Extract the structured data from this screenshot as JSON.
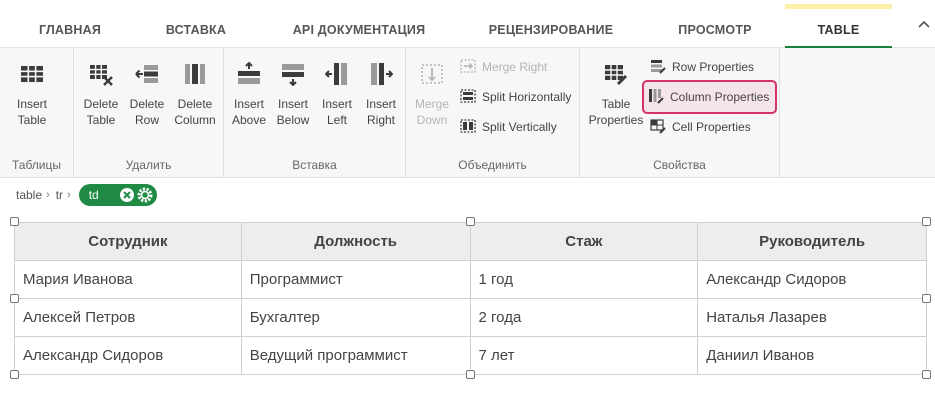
{
  "tabs": [
    {
      "label": "ГЛАВНАЯ"
    },
    {
      "label": "ВСТАВКА"
    },
    {
      "label": "API ДОКУМЕНТАЦИЯ"
    },
    {
      "label": "РЕЦЕНЗИРОВАНИЕ"
    },
    {
      "label": "ПРОСМОТР"
    },
    {
      "label": "TABLE"
    }
  ],
  "active_tab": "TABLE",
  "ribbon": {
    "groups": {
      "tables": {
        "label": "Таблицы",
        "buttons": [
          {
            "line1": "Insert",
            "line2": "Table",
            "icon": "table-grid-icon"
          }
        ]
      },
      "delete": {
        "label": "Удалить",
        "buttons": [
          {
            "line1": "Delete",
            "line2": "Table",
            "icon": "delete-table-icon"
          },
          {
            "line1": "Delete",
            "line2": "Row",
            "icon": "delete-row-icon"
          },
          {
            "line1": "Delete",
            "line2": "Column",
            "icon": "delete-column-icon"
          }
        ]
      },
      "insert": {
        "label": "Вставка",
        "buttons": [
          {
            "line1": "Insert",
            "line2": "Above",
            "icon": "insert-above-icon"
          },
          {
            "line1": "Insert",
            "line2": "Below",
            "icon": "insert-below-icon"
          },
          {
            "line1": "Insert",
            "line2": "Left",
            "icon": "insert-left-icon"
          },
          {
            "line1": "Insert",
            "line2": "Right",
            "icon": "insert-right-icon"
          }
        ]
      },
      "merge": {
        "label": "Объединить",
        "buttons": [
          {
            "line1": "Merge",
            "line2": "Down",
            "icon": "merge-down-icon",
            "disabled": true
          }
        ],
        "small": [
          {
            "label": "Merge Right",
            "icon": "merge-right-icon",
            "disabled": true
          },
          {
            "label": "Split Horizontally",
            "icon": "split-horizontal-icon"
          },
          {
            "label": "Split Vertically",
            "icon": "split-vertical-icon"
          }
        ]
      },
      "properties": {
        "label": "Свойства",
        "buttons": [
          {
            "line1": "Table",
            "line2": "Properties",
            "icon": "table-properties-icon"
          }
        ],
        "small": [
          {
            "label": "Row Properties",
            "icon": "row-properties-icon"
          },
          {
            "label": "Column Properties",
            "icon": "column-properties-icon",
            "highlighted": true
          },
          {
            "label": "Cell Properties",
            "icon": "cell-properties-icon"
          }
        ]
      }
    }
  },
  "breadcrumb": {
    "items": [
      "table",
      "tr"
    ],
    "current": "td"
  },
  "table": {
    "headers": [
      "Сотрудник",
      "Должность",
      "Стаж",
      "Руководитель"
    ],
    "rows": [
      [
        "Мария Иванова",
        "Программист",
        "1 год",
        "Александр Сидоров"
      ],
      [
        "Алексей Петров",
        "Бухгалтер",
        "2 года",
        "Наталья Лазарев"
      ],
      [
        "Александр Сидоров",
        "Ведущий программист",
        "7 лет",
        "Даниил Иванов"
      ]
    ]
  },
  "colors": {
    "accent_green": "#1e8a43",
    "active_tab_marker": "#fdf0a8",
    "highlight_border": "#d2336a",
    "highlight_fill": "#f6e4ec"
  }
}
